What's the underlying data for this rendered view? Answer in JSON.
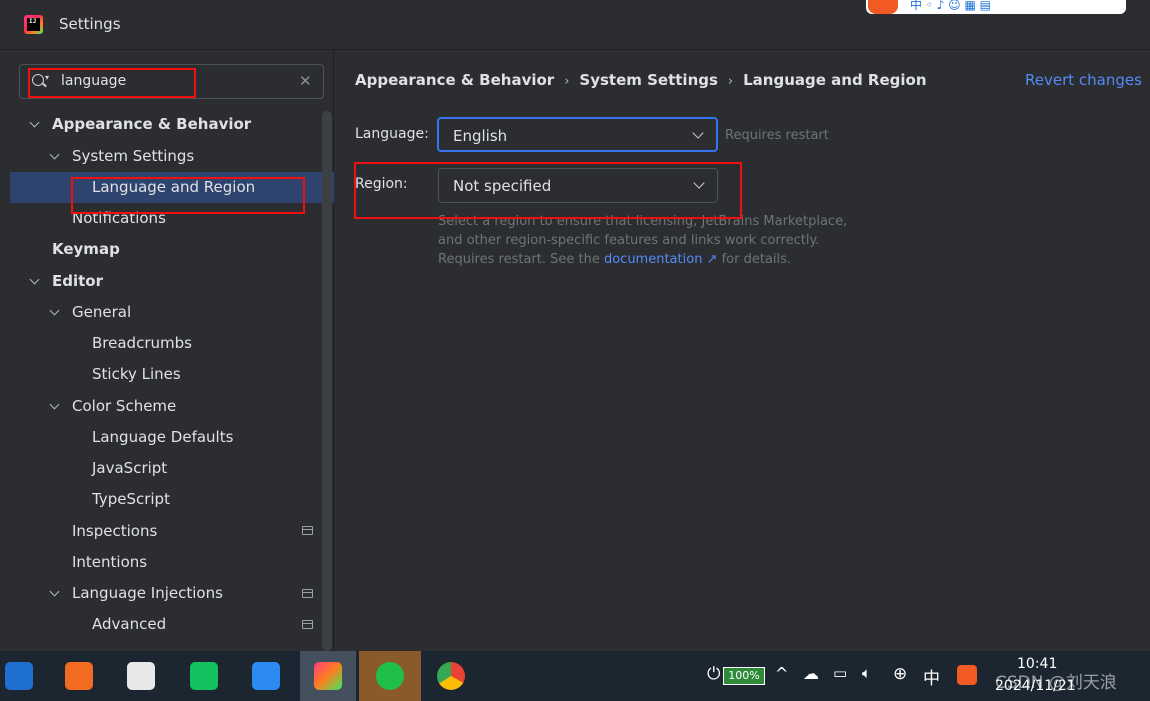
{
  "window": {
    "title": "Settings"
  },
  "top_tray": {
    "text": "中 ◦ ♪ ☺ ▦ ▤"
  },
  "search": {
    "value": "language"
  },
  "tree": [
    {
      "label": "Appearance & Behavior"
    },
    {
      "label": "System Settings"
    },
    {
      "label": "Language and Region"
    },
    {
      "label": "Notifications"
    },
    {
      "label": "Keymap"
    },
    {
      "label": "Editor"
    },
    {
      "label": "General"
    },
    {
      "label": "Breadcrumbs"
    },
    {
      "label": "Sticky Lines"
    },
    {
      "label": "Color Scheme"
    },
    {
      "label": "Language Defaults"
    },
    {
      "label": "JavaScript"
    },
    {
      "label": "TypeScript"
    },
    {
      "label": "Inspections"
    },
    {
      "label": "Intentions"
    },
    {
      "label": "Language Injections"
    },
    {
      "label": "Advanced"
    }
  ],
  "breadcrumb": [
    "Appearance & Behavior",
    "System Settings",
    "Language and Region"
  ],
  "revert_label": "Revert changes",
  "form": {
    "language_label": "Language:",
    "language_value": "English",
    "requires_restart": "Requires restart",
    "region_label": "Region:",
    "region_value": "Not specified",
    "desc_1": "Select a region to ensure that licensing, JetBrains Marketplace, and other region-specific features and links work correctly. Requires restart. See the ",
    "desc_link": "documentation ↗",
    "desc_2": "  for details."
  },
  "taskbar": {
    "battery": "100%",
    "ime": "中",
    "time": "10:41",
    "date": "2024/11/21",
    "watermark": "CSDN @刘天浪"
  },
  "colors": {
    "accent": "#3574f0",
    "link": "#548af7",
    "highlight_box": "#f01010",
    "selection": "#2e436e"
  }
}
